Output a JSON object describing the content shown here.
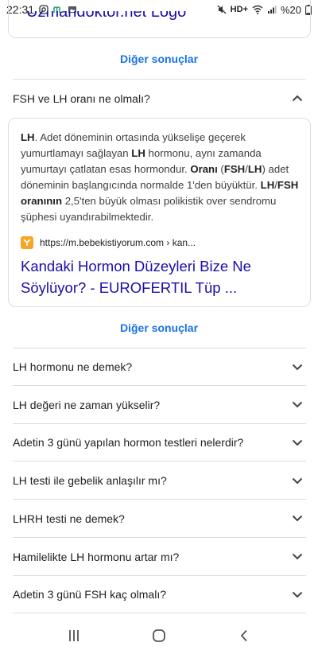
{
  "status_bar": {
    "time": "22:31",
    "network": "HD+",
    "battery": "%20",
    "left_icons": [
      "instagram-icon",
      "app-m-icon",
      "gallery-icon"
    ],
    "right_icons": [
      "mute-icon",
      "wifi-icon",
      "signal-icon",
      "battery-icon"
    ]
  },
  "top_card": {
    "partial_text": "Uzmandoktor.net Logo"
  },
  "more_results_1": "Diğer sonuçlar",
  "expanded_question": {
    "text": "FSH ve LH oranı ne olmalı?"
  },
  "answer": {
    "parts": [
      {
        "t": "LH",
        "b": true
      },
      {
        "t": ". Adet döneminin ortasında yükselişe geçerek yumurtlamayı sağlayan ",
        "b": false
      },
      {
        "t": "LH",
        "b": true
      },
      {
        "t": " hormonu, aynı zamanda yumurtayı çatlatan esas hormondur. ",
        "b": false
      },
      {
        "t": "Oranı",
        "b": true
      },
      {
        "t": " (",
        "b": false
      },
      {
        "t": "FSH",
        "b": true
      },
      {
        "t": "/",
        "b": false
      },
      {
        "t": "LH",
        "b": true
      },
      {
        "t": ") adet döneminin başlangıcında normalde 1'den büyüktür. ",
        "b": false
      },
      {
        "t": "LH",
        "b": true
      },
      {
        "t": "/",
        "b": false
      },
      {
        "t": "FSH oranının",
        "b": true
      },
      {
        "t": " 2,5'ten büyük olması polikistik over sendromu şüphesi uyandırabilmektedir.",
        "b": false
      }
    ],
    "source_url": "https://m.bebekistiyorum.com › kan...",
    "link_title": "Kandaki Hormon Düzeyleri Bize Ne Söylüyor? - EUROFERTIL Tüp ..."
  },
  "more_results_2": "Diğer sonuçlar",
  "questions": [
    "LH hormonu ne demek?",
    "LH değeri ne zaman yükselir?",
    "Adetin 3 günü yapılan hormon testleri nelerdir?",
    "LH testi ile gebelik anlaşılır mı?",
    "LHRH testi ne demek?",
    "Hamilelikte LH hormonu artar mı?",
    "Adetin 3 günü FSH kaç olmalı?"
  ],
  "colors": {
    "link_blue": "#1a0dab",
    "accent_blue": "#1a73e8",
    "divider": "#dadce0",
    "favicon": "#f5a623"
  }
}
